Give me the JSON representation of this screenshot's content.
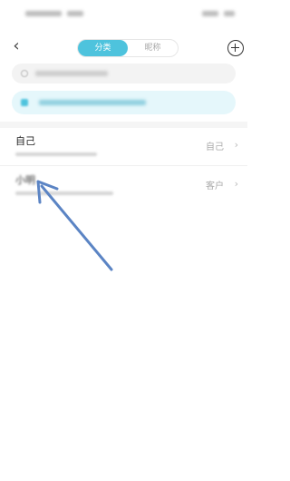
{
  "nav": {
    "back_icon": "chevron-left-icon",
    "tabs": [
      {
        "label": "分类",
        "active": true
      },
      {
        "label": "昵称",
        "active": false
      }
    ],
    "add_icon": "plus-circle-icon"
  },
  "contacts": [
    {
      "name": "自己",
      "tag": "自己"
    },
    {
      "name": "小明",
      "tag": "客户"
    }
  ],
  "colors": {
    "accent": "#4ec3dd",
    "annotation_arrow": "#5b84c4"
  }
}
